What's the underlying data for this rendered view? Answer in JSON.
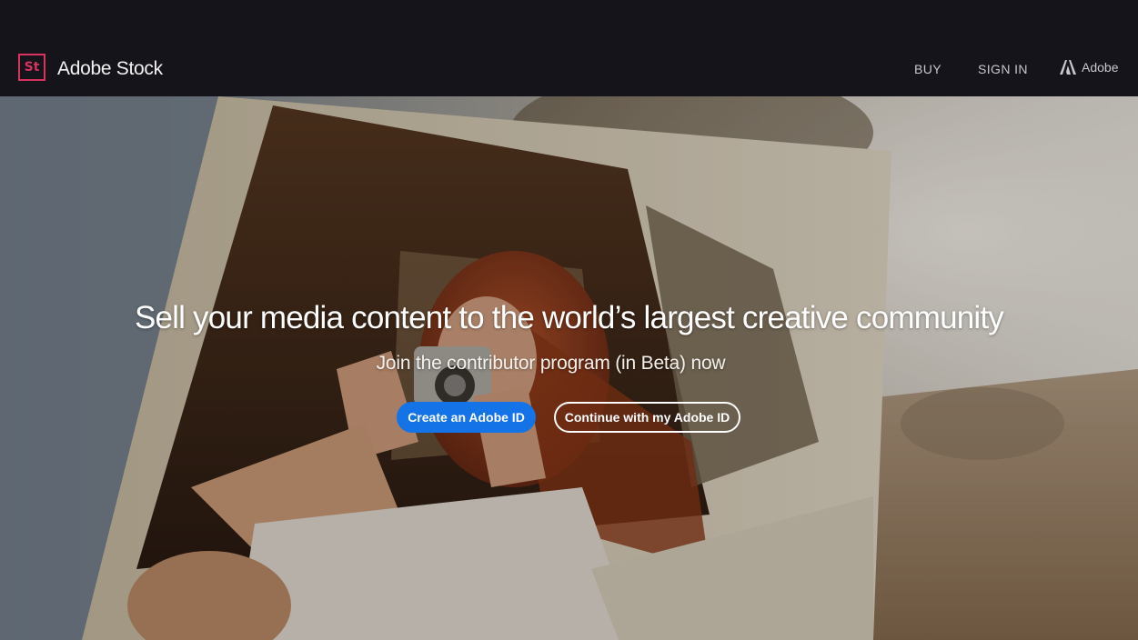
{
  "header": {
    "logo_text": "St",
    "brand": "Adobe Stock",
    "nav": {
      "buy": "BUY",
      "sign_in": "SIGN IN",
      "adobe": "Adobe"
    }
  },
  "hero": {
    "headline": "Sell your media content to the world’s largest creative community",
    "subhead": "Join the contributor program (in Beta) now",
    "primary_button": "Create an Adobe ID",
    "secondary_button": "Continue with my Adobe ID"
  },
  "colors": {
    "accent": "#1473e6",
    "brand": "#d8325e",
    "header_bg": "#15141b"
  },
  "icons": {
    "adobe_logo": "adobe-logo-icon"
  }
}
